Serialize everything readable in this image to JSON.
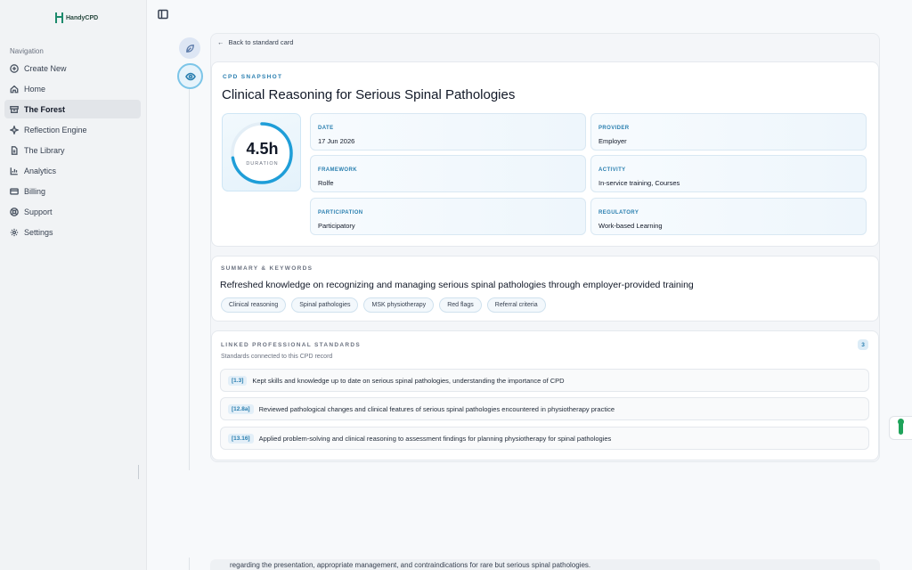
{
  "app": {
    "logo_text": "HandyCPD"
  },
  "sidebar": {
    "heading": "Navigation",
    "items": [
      {
        "label": "Create New",
        "icon": "plus-circle-icon"
      },
      {
        "label": "Home",
        "icon": "home-icon"
      },
      {
        "label": "The Forest",
        "icon": "archive-icon",
        "active": true
      },
      {
        "label": "Reflection Engine",
        "icon": "sparkle-icon"
      },
      {
        "label": "The Library",
        "icon": "document-icon"
      },
      {
        "label": "Analytics",
        "icon": "bar-chart-icon"
      },
      {
        "label": "Billing",
        "icon": "credit-card-icon"
      },
      {
        "label": "Support",
        "icon": "lifebuoy-icon"
      },
      {
        "label": "Settings",
        "icon": "gear-icon"
      }
    ]
  },
  "main": {
    "back_label": "Back to standard card",
    "snapshot": {
      "eyebrow": "CPD SNAPSHOT",
      "title": "Clinical Reasoning for Serious Spinal Pathologies",
      "duration_value": "4.5h",
      "duration_label": "DURATION",
      "fields": {
        "date": {
          "label": "DATE",
          "value": "17 Jun 2026"
        },
        "provider": {
          "label": "PROVIDER",
          "value": "Employer"
        },
        "framework": {
          "label": "FRAMEWORK",
          "value": "Rolfe"
        },
        "activity": {
          "label": "ACTIVITY",
          "value": "In-service training, Courses"
        },
        "participation": {
          "label": "PARTICIPATION",
          "value": "Participatory"
        },
        "regulatory": {
          "label": "REGULATORY",
          "value": "Work-based Learning"
        }
      }
    },
    "summary": {
      "eyebrow": "SUMMARY & KEYWORDS",
      "text": "Refreshed knowledge on recognizing and managing serious spinal pathologies through employer-provided training",
      "tags": [
        "Clinical reasoning",
        "Spinal pathologies",
        "MSK physiotherapy",
        "Red flags",
        "Referral criteria"
      ]
    },
    "standards": {
      "eyebrow": "LINKED PROFESSIONAL STANDARDS",
      "subtitle": "Standards connected to this CPD record",
      "count": "3",
      "items": [
        {
          "code": "[1.3]",
          "text": "Kept skills and knowledge up to date on serious spinal pathologies, understanding the importance of CPD"
        },
        {
          "code": "[12.8a]",
          "text": "Reviewed pathological changes and clinical features of serious spinal pathologies encountered in physiotherapy practice"
        },
        {
          "code": "[13.16]",
          "text": "Applied problem-solving and clinical reasoning to assessment findings for planning physiotherapy for spinal pathologies"
        }
      ]
    },
    "bottom_text": "regarding the presentation, appropriate management, and contraindications for rare but serious spinal pathologies."
  },
  "colors": {
    "accent": "#2a7fb0",
    "ring": "#1f9ed8",
    "brand": "#1c8a6c"
  }
}
